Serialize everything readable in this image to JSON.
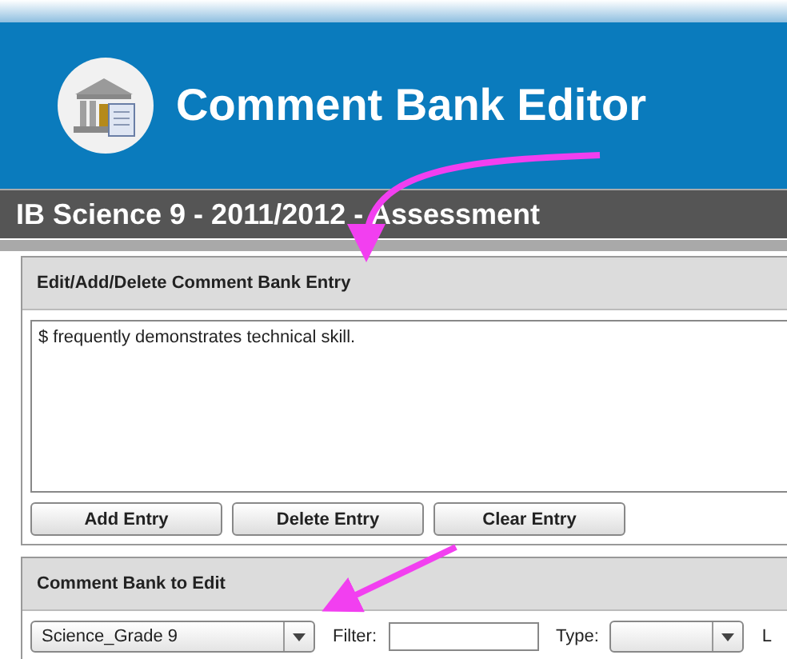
{
  "header": {
    "title": "Comment Bank Editor"
  },
  "course_bar": {
    "title": "IB Science 9 - 2011/2012 - Assessment"
  },
  "entry_panel": {
    "title": "Edit/Add/Delete Comment Bank Entry",
    "text": "$ frequently demonstrates technical skill.",
    "buttons": [
      "Add Entry",
      "Delete Entry",
      "Clear Entry"
    ]
  },
  "bank_panel": {
    "title": "Comment Bank to Edit",
    "bank_select": "Science_Grade 9",
    "filter_label": "Filter:",
    "type_label": "Type:",
    "column_4_label": "L"
  }
}
